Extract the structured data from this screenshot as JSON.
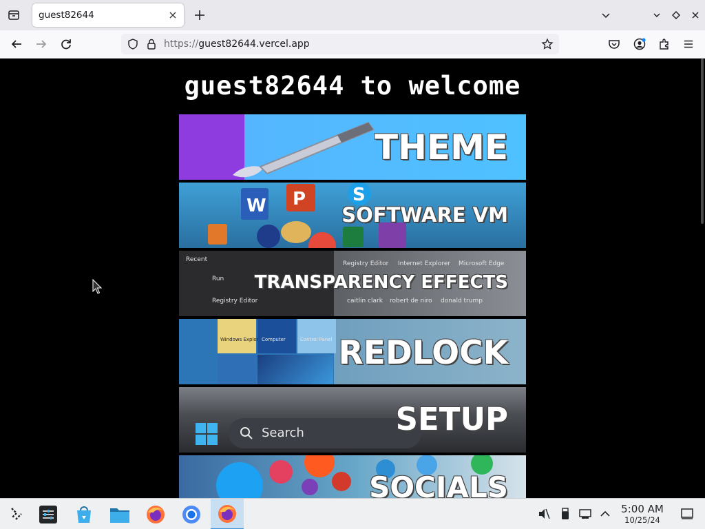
{
  "browser": {
    "tab_title": "guest82644",
    "url_protocol": "https://",
    "url_host": "guest82644.vercel.app"
  },
  "page": {
    "heading": "guest82644 to welcome",
    "banners": [
      {
        "label": "THEME"
      },
      {
        "label": "SOFTWARE VM"
      },
      {
        "label": "TRANSPARENCY EFFECTS"
      },
      {
        "label": "REDLOCK"
      },
      {
        "label": "SETUP"
      },
      {
        "label": "SOCIALS"
      }
    ],
    "transparency_details": {
      "recent": "Recent",
      "run": "Run",
      "registry": "Registry Editor",
      "pins": [
        "Registry Editor",
        "Internet Explorer",
        "Microsoft Edge"
      ],
      "people": [
        "caitlin clark",
        "robert de niro",
        "donald trump"
      ]
    },
    "redlock_tiles": [
      "Windows Explorer",
      "Computer",
      "Control Panel"
    ],
    "setup_search": "Search"
  },
  "taskbar": {
    "clock_time": "5:00 AM",
    "clock_date": "10/25/24",
    "apps": [
      "app-launcher-icon",
      "system-settings-icon",
      "discover-store-icon",
      "file-manager-icon",
      "firefox-icon",
      "chromium-icon",
      "firefox-active-icon"
    ]
  },
  "colors": {
    "taskbar_bg": "#eef0f2",
    "active_app_highlight": "#c8def1",
    "page_bg": "#000000",
    "theme_purple": "#8e3be0",
    "theme_blue": "#4fc1ff"
  }
}
